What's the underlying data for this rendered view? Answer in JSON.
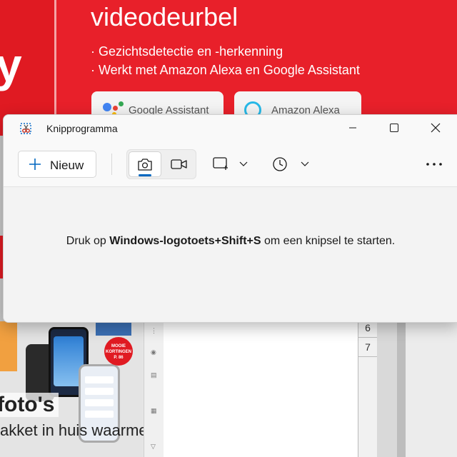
{
  "window": {
    "title": "Knipprogramma",
    "new_button_label": "Nieuw",
    "hint": {
      "before": "Druk op ",
      "shortcut": "Windows-logotoets+Shift+S",
      "after": " om een knipsel te starten."
    },
    "selected_mode": "photo",
    "accent_color": "#0067c0"
  },
  "background": {
    "ad": {
      "big_letter": "y",
      "headline": "videodeurbel",
      "bullets": [
        "· Gezichtsdetectie en -herkenning",
        "· Werkt met Amazon Alexa en Google Assistant"
      ],
      "buttons": [
        "Google Assistant",
        "Amazon Alexa"
      ],
      "color": "#e8202a"
    },
    "article": {
      "title": "foto's",
      "subtitle": "akket in huis waarmee je foto’s kunt",
      "badge": "MOOIE KORTINGEN P. 86"
    },
    "sheet": {
      "row_numbers": [
        "6",
        "7"
      ]
    }
  }
}
